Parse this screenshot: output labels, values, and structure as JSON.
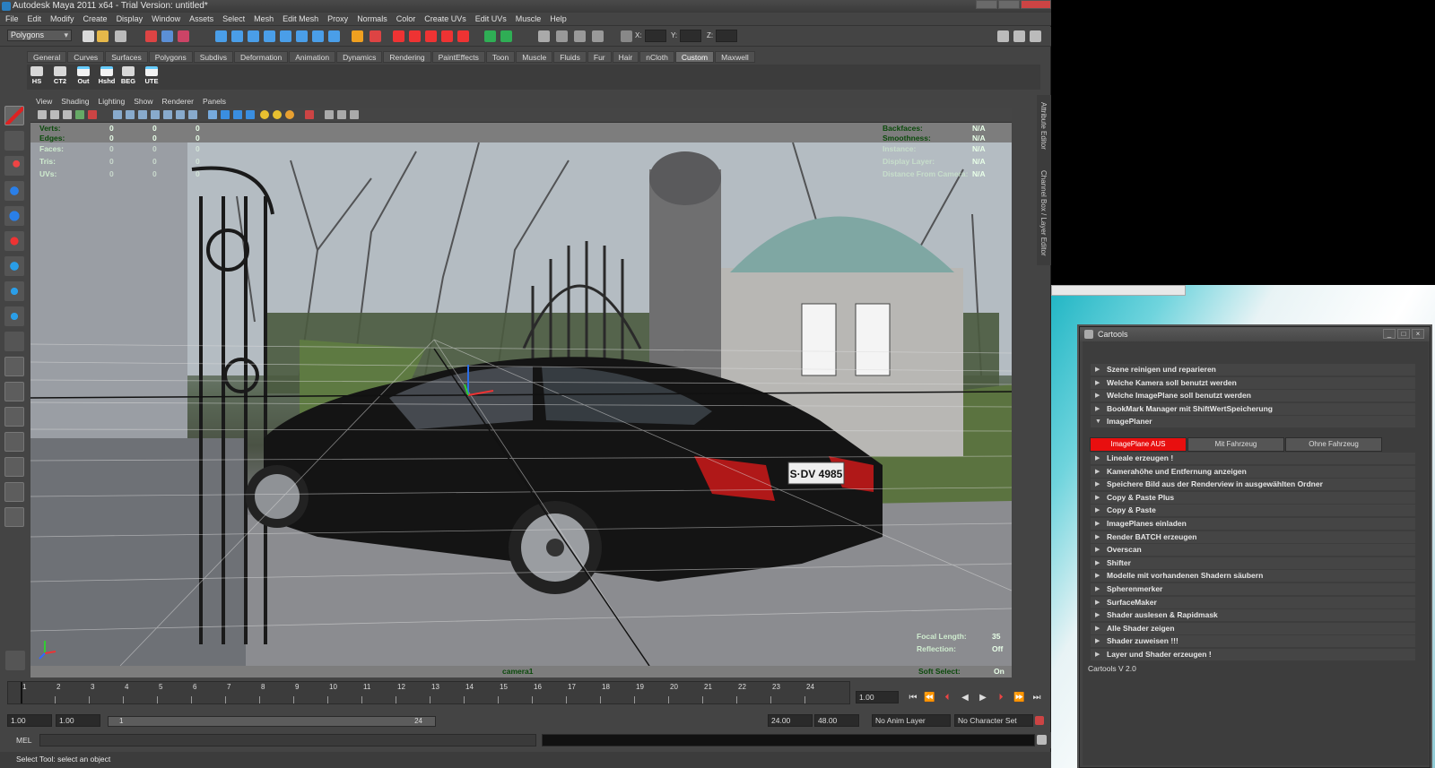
{
  "window": {
    "title": "Autodesk Maya 2011 x64 - Trial Version: untitled*"
  },
  "menu": [
    "File",
    "Edit",
    "Modify",
    "Create",
    "Display",
    "Window",
    "Assets",
    "Select",
    "Mesh",
    "Edit Mesh",
    "Proxy",
    "Normals",
    "Color",
    "Create UVs",
    "Edit UVs",
    "Muscle",
    "Help"
  ],
  "status_line": {
    "mode": "Polygons",
    "x_label": "X:",
    "y_label": "Y:",
    "z_label": "Z:"
  },
  "shelf": {
    "tabs": [
      "General",
      "Curves",
      "Surfaces",
      "Polygons",
      "Subdivs",
      "Deformation",
      "Animation",
      "Dynamics",
      "Rendering",
      "PaintEffects",
      "Toon",
      "Muscle",
      "Fluids",
      "Fur",
      "Hair",
      "nCloth",
      "Custom",
      "Maxwell"
    ],
    "active_tab": "Custom",
    "buttons": [
      "HS",
      "CT2",
      "Out",
      "Hshd",
      "BEG",
      "UTE"
    ]
  },
  "panel_menu": [
    "View",
    "Shading",
    "Lighting",
    "Show",
    "Renderer",
    "Panels"
  ],
  "hud": {
    "left": [
      {
        "label": "Verts:",
        "values": [
          "0",
          "0",
          "0"
        ]
      },
      {
        "label": "Edges:",
        "values": [
          "0",
          "0",
          "0"
        ]
      },
      {
        "label": "Faces:",
        "values": [
          "0",
          "0",
          "0"
        ]
      },
      {
        "label": "Tris:",
        "values": [
          "0",
          "0",
          "0"
        ]
      },
      {
        "label": "UVs:",
        "values": [
          "0",
          "0",
          "0"
        ]
      }
    ],
    "right": [
      {
        "label": "Backfaces:",
        "value": "N/A"
      },
      {
        "label": "Smoothness:",
        "value": "N/A"
      },
      {
        "label": "Instance:",
        "value": "N/A"
      },
      {
        "label": "Display Layer:",
        "value": "N/A"
      },
      {
        "label": "Distance From Camera:",
        "value": "N/A"
      }
    ],
    "focal_length_label": "Focal Length:",
    "focal_length": "35",
    "reflection_label": "Reflection:",
    "reflection": "Off",
    "soft_select_label": "Soft Select:",
    "soft_select": "On",
    "camera": "camera1"
  },
  "viewport": {
    "plate_text": "S·DV 4985"
  },
  "timeline": {
    "ticks": [
      "1",
      "2",
      "3",
      "4",
      "5",
      "6",
      "7",
      "8",
      "9",
      "10",
      "11",
      "12",
      "13",
      "14",
      "15",
      "16",
      "17",
      "18",
      "19",
      "20",
      "21",
      "22",
      "23",
      "24"
    ],
    "current_frame": "1.00",
    "start": "1.00",
    "playback_start": "1.00",
    "range_start": "1",
    "range_end": "24",
    "playback_end": "24.00",
    "end": "48.00",
    "anim_layer": "No Anim Layer",
    "character_set": "No Character Set"
  },
  "command_line": {
    "label": "MEL"
  },
  "help_line": "Select Tool: select an object",
  "right_dock": {
    "tab1": "Attribute Editor",
    "tab2": "Channel Box / Layer Editor"
  },
  "cartools": {
    "title": "Cartools",
    "version": "Cartools V 2.0",
    "items_before": [
      "Szene reinigen und reparieren",
      "Welche Kamera soll benutzt werden",
      "Welche ImagePlane soll benutzt werden",
      "BookMark Manager mit ShiftWertSpeicherung",
      "ImagePlaner"
    ],
    "buttons": [
      {
        "label": "ImagePlane AUS",
        "active": true
      },
      {
        "label": "Mit Fahrzeug",
        "active": false
      },
      {
        "label": "Ohne Fahrzeug",
        "active": false
      }
    ],
    "items_after": [
      "Lineale erzeugen !",
      "Kamerahöhe und Entfernung anzeigen",
      "Speichere Bild aus der Renderview in ausgewählten Ordner",
      "Copy & Paste Plus",
      "Copy & Paste",
      "ImagePlanes einladen",
      "Render BATCH erzeugen",
      "Overscan",
      "Shifter",
      "Modelle mit vorhandenen Shadern säubern",
      "Spherenmerker",
      "SurfaceMaker",
      "Shader auslesen & Rapidmask",
      "Alle Shader zeigen",
      "Shader zuweisen !!!",
      "Layer und Shader erzeugen !"
    ]
  },
  "colors": {
    "accent_red": "#e80f0f",
    "maya_bg": "#444444",
    "hud_green": "#0a4a0a"
  }
}
